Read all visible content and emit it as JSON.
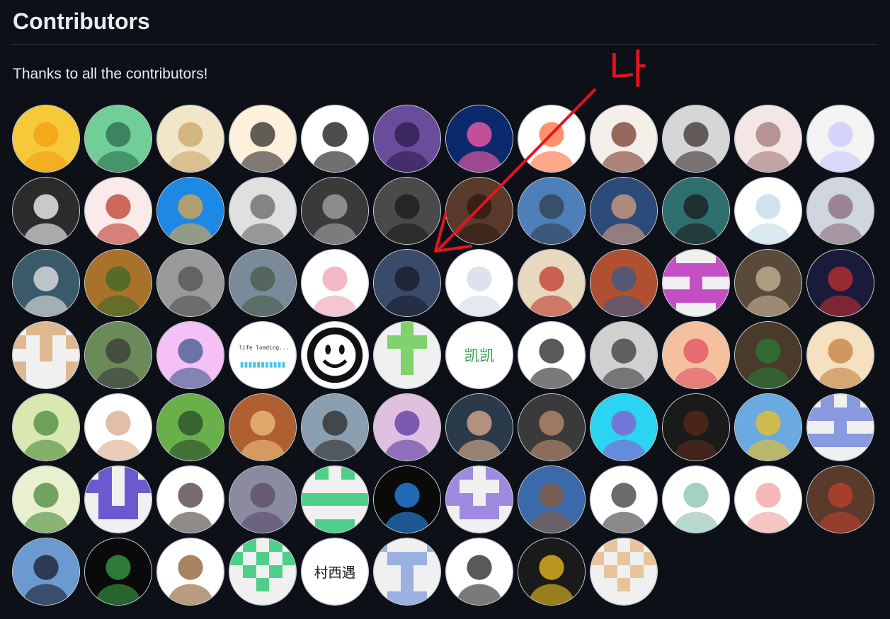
{
  "page": {
    "title": "Contributors",
    "thanks_text": "Thanks to all the contributors!"
  },
  "annotation": {
    "text": "나",
    "color": "#e8131f"
  },
  "avatars": [
    {
      "kind": "photo",
      "palette": [
        "#f6c93b",
        "#f39c12"
      ]
    },
    {
      "kind": "photo",
      "palette": [
        "#6fcf97",
        "#2d6a4f"
      ]
    },
    {
      "kind": "photo",
      "palette": [
        "#f2e6c9",
        "#c9a66b"
      ]
    },
    {
      "kind": "photo",
      "palette": [
        "#fdf1dc",
        "#2b2b2b"
      ]
    },
    {
      "kind": "photo",
      "palette": [
        "#ffffff",
        "#111111"
      ]
    },
    {
      "kind": "photo",
      "palette": [
        "#6a4c9c",
        "#2c1a4d"
      ]
    },
    {
      "kind": "photo",
      "palette": [
        "#0b2a6e",
        "#ff5ea8"
      ]
    },
    {
      "kind": "photo",
      "palette": [
        "#ffffff",
        "#ff6b3d"
      ]
    },
    {
      "kind": "photo",
      "palette": [
        "#f4efe9",
        "#7a3b2e"
      ]
    },
    {
      "kind": "photo",
      "palette": [
        "#d6d6d6",
        "#3b2f2f"
      ]
    },
    {
      "kind": "photo",
      "palette": [
        "#f5e6e6",
        "#a07878"
      ]
    },
    {
      "kind": "photo",
      "palette": [
        "#f3f3f3",
        "#c8c8ff"
      ]
    },
    {
      "kind": "photo",
      "palette": [
        "#2b2b2b",
        "#ffffff"
      ]
    },
    {
      "kind": "photo",
      "palette": [
        "#fbeaea",
        "#c0392b"
      ]
    },
    {
      "kind": "photo",
      "palette": [
        "#1e88e5",
        "#e0a64a"
      ]
    },
    {
      "kind": "photo",
      "palette": [
        "#e0e0e0",
        "#666666"
      ]
    },
    {
      "kind": "photo",
      "palette": [
        "#3a3a3a",
        "#a8a8a8"
      ]
    },
    {
      "kind": "photo",
      "palette": [
        "#4a4a4a",
        "#1a1a1a"
      ]
    },
    {
      "kind": "photo",
      "palette": [
        "#5a3a2a",
        "#2a1a12"
      ]
    },
    {
      "kind": "photo",
      "palette": [
        "#4f7fb8",
        "#2f3f4f"
      ]
    },
    {
      "kind": "photo",
      "palette": [
        "#2c4a7a",
        "#d8a080"
      ]
    },
    {
      "kind": "photo",
      "palette": [
        "#2f6f6f",
        "#1a1a1a"
      ]
    },
    {
      "kind": "photo",
      "palette": [
        "#ffffff",
        "#bfd8e8"
      ]
    },
    {
      "kind": "photo",
      "palette": [
        "#cfd6df",
        "#8a6a7a"
      ]
    },
    {
      "kind": "photo",
      "palette": [
        "#3a5a6a",
        "#e8e8e8"
      ]
    },
    {
      "kind": "photo",
      "palette": [
        "#a8722a",
        "#3a6a2a"
      ]
    },
    {
      "kind": "photo",
      "palette": [
        "#9a9a9a",
        "#505050"
      ]
    },
    {
      "kind": "photo",
      "palette": [
        "#7a8a9a",
        "#4a5a4a"
      ]
    },
    {
      "kind": "photo",
      "palette": [
        "#ffffff",
        "#f0a0b0"
      ]
    },
    {
      "kind": "photo",
      "palette": [
        "#3a4a6a",
        "#1a1a2a"
      ]
    },
    {
      "kind": "photo",
      "palette": [
        "#ffffff",
        "#d0d8e8"
      ]
    },
    {
      "kind": "photo",
      "palette": [
        "#e8d8c0",
        "#c0392b"
      ]
    },
    {
      "kind": "photo",
      "palette": [
        "#b05030",
        "#3a5a8a"
      ]
    },
    {
      "kind": "identicon",
      "color": "#c44fc4",
      "pattern": [
        1,
        0,
        0,
        0,
        1,
        1,
        1,
        1,
        1,
        1,
        0,
        0,
        1,
        0,
        0,
        1,
        1,
        1,
        1,
        1,
        1,
        0,
        0,
        0,
        1
      ]
    },
    {
      "kind": "photo",
      "palette": [
        "#5a4a3a",
        "#c8b898"
      ]
    },
    {
      "kind": "photo",
      "palette": [
        "#1a1a3a",
        "#c03030"
      ]
    },
    {
      "kind": "identicon",
      "color": "#dfb892",
      "pattern": [
        0,
        1,
        1,
        1,
        0,
        1,
        0,
        1,
        0,
        1,
        0,
        0,
        1,
        0,
        0,
        1,
        0,
        0,
        0,
        1,
        1,
        0,
        0,
        0,
        1
      ]
    },
    {
      "kind": "photo",
      "palette": [
        "#6a8a5a",
        "#3a3a3a"
      ]
    },
    {
      "kind": "photo",
      "palette": [
        "#f5c0f5",
        "#3a5a8a"
      ]
    },
    {
      "kind": "loading",
      "text": "life loading..."
    },
    {
      "kind": "smiley"
    },
    {
      "kind": "identicon",
      "color": "#7fd36a",
      "pattern": [
        0,
        0,
        1,
        0,
        0,
        0,
        1,
        1,
        1,
        0,
        0,
        0,
        1,
        0,
        0,
        0,
        0,
        1,
        0,
        0,
        0,
        0,
        0,
        0,
        0
      ]
    },
    {
      "kind": "text",
      "text": "凯凯",
      "color": "#3a9a4a"
    },
    {
      "kind": "photo",
      "palette": [
        "#ffffff",
        "#222222"
      ]
    },
    {
      "kind": "photo",
      "palette": [
        "#d0d0d0",
        "#3a3a3a"
      ]
    },
    {
      "kind": "photo",
      "palette": [
        "#f5c0a0",
        "#e05060"
      ]
    },
    {
      "kind": "photo",
      "palette": [
        "#4a3a2a",
        "#2a7a3a"
      ]
    },
    {
      "kind": "photo",
      "palette": [
        "#f5e0c0",
        "#c08040"
      ]
    },
    {
      "kind": "photo",
      "palette": [
        "#d8e8b0",
        "#4a8a3a"
      ]
    },
    {
      "kind": "photo",
      "palette": [
        "#ffffff",
        "#d8a888"
      ]
    },
    {
      "kind": "photo",
      "palette": [
        "#6ab04a",
        "#2a4a2a"
      ]
    },
    {
      "kind": "photo",
      "palette": [
        "#b06030",
        "#f0c080"
      ]
    },
    {
      "kind": "photo",
      "palette": [
        "#8aa0b0",
        "#2a2a2a"
      ]
    },
    {
      "kind": "photo",
      "palette": [
        "#e0c0e0",
        "#5a3aa0"
      ]
    },
    {
      "kind": "photo",
      "palette": [
        "#2a3a4a",
        "#e0b090"
      ]
    },
    {
      "kind": "photo",
      "palette": [
        "#3a3a3a",
        "#c09070"
      ]
    },
    {
      "kind": "photo",
      "palette": [
        "#2bd4f0",
        "#8a5ad0"
      ]
    },
    {
      "kind": "photo",
      "palette": [
        "#1a1a1a",
        "#5a2a1a"
      ]
    },
    {
      "kind": "photo",
      "palette": [
        "#6aaae0",
        "#f0c020"
      ]
    },
    {
      "kind": "identicon",
      "color": "#8a9ae0",
      "pattern": [
        0,
        1,
        0,
        1,
        0,
        1,
        1,
        1,
        1,
        1,
        0,
        0,
        1,
        0,
        0,
        1,
        1,
        1,
        1,
        1,
        0,
        0,
        0,
        0,
        0
      ]
    },
    {
      "kind": "photo",
      "palette": [
        "#e8f0d0",
        "#4a8a3a"
      ]
    },
    {
      "kind": "identicon",
      "color": "#6a5acd",
      "pattern": [
        0,
        1,
        0,
        1,
        0,
        1,
        1,
        0,
        1,
        1,
        0,
        1,
        0,
        1,
        0,
        0,
        1,
        1,
        1,
        0,
        0,
        0,
        0,
        0,
        0
      ]
    },
    {
      "kind": "photo",
      "palette": [
        "#ffffff",
        "#4a3a3a"
      ]
    },
    {
      "kind": "photo",
      "palette": [
        "#8a8aa0",
        "#5a4a6a"
      ]
    },
    {
      "kind": "identicon",
      "color": "#4fd08a",
      "pattern": [
        0,
        1,
        0,
        1,
        0,
        0,
        0,
        0,
        0,
        0,
        1,
        1,
        1,
        1,
        1,
        0,
        0,
        0,
        0,
        0,
        0,
        1,
        1,
        1,
        0
      ]
    },
    {
      "kind": "photo",
      "palette": [
        "#0a0a0a",
        "#2a8af0"
      ]
    },
    {
      "kind": "identicon",
      "color": "#a08ae0",
      "pattern": [
        1,
        1,
        0,
        1,
        1,
        1,
        0,
        0,
        0,
        1,
        1,
        1,
        0,
        1,
        1,
        0,
        1,
        1,
        1,
        0,
        0,
        0,
        0,
        0,
        0
      ]
    },
    {
      "kind": "photo",
      "palette": [
        "#3a6aaa",
        "#8a5a3a"
      ]
    },
    {
      "kind": "photo",
      "palette": [
        "#ffffff",
        "#3a3a3a"
      ]
    },
    {
      "kind": "photo",
      "palette": [
        "#ffffff",
        "#8ac0b0"
      ]
    },
    {
      "kind": "photo",
      "palette": [
        "#ffffff",
        "#f0a0a0"
      ]
    },
    {
      "kind": "photo",
      "palette": [
        "#5a3a2a",
        "#c04030"
      ]
    },
    {
      "kind": "photo",
      "palette": [
        "#6a9ad0",
        "#1a1a2a"
      ]
    },
    {
      "kind": "photo",
      "palette": [
        "#0a0a0a",
        "#3aa04a"
      ]
    },
    {
      "kind": "photo",
      "palette": [
        "#ffffff",
        "#8a5a2a"
      ]
    },
    {
      "kind": "identicon",
      "color": "#4fd08a",
      "pattern": [
        0,
        1,
        0,
        1,
        0,
        1,
        0,
        1,
        0,
        1,
        0,
        1,
        0,
        1,
        0,
        0,
        0,
        1,
        0,
        0,
        0,
        0,
        0,
        0,
        0
      ]
    },
    {
      "kind": "text",
      "text": "村西遇",
      "color": "#1a1a1a"
    },
    {
      "kind": "identicon",
      "color": "#9ab0e0",
      "pattern": [
        1,
        0,
        0,
        0,
        1,
        0,
        1,
        1,
        1,
        0,
        0,
        0,
        1,
        0,
        0,
        0,
        0,
        1,
        0,
        0,
        0,
        1,
        1,
        1,
        0
      ]
    },
    {
      "kind": "photo",
      "palette": [
        "#ffffff",
        "#222222"
      ]
    },
    {
      "kind": "photo",
      "palette": [
        "#1a1a1a",
        "#f0c020"
      ]
    },
    {
      "kind": "identicon",
      "color": "#e8c49a",
      "pattern": [
        0,
        1,
        0,
        1,
        0,
        1,
        0,
        1,
        0,
        1,
        0,
        1,
        0,
        1,
        0,
        0,
        0,
        1,
        0,
        0,
        0,
        0,
        0,
        0,
        0
      ]
    }
  ]
}
